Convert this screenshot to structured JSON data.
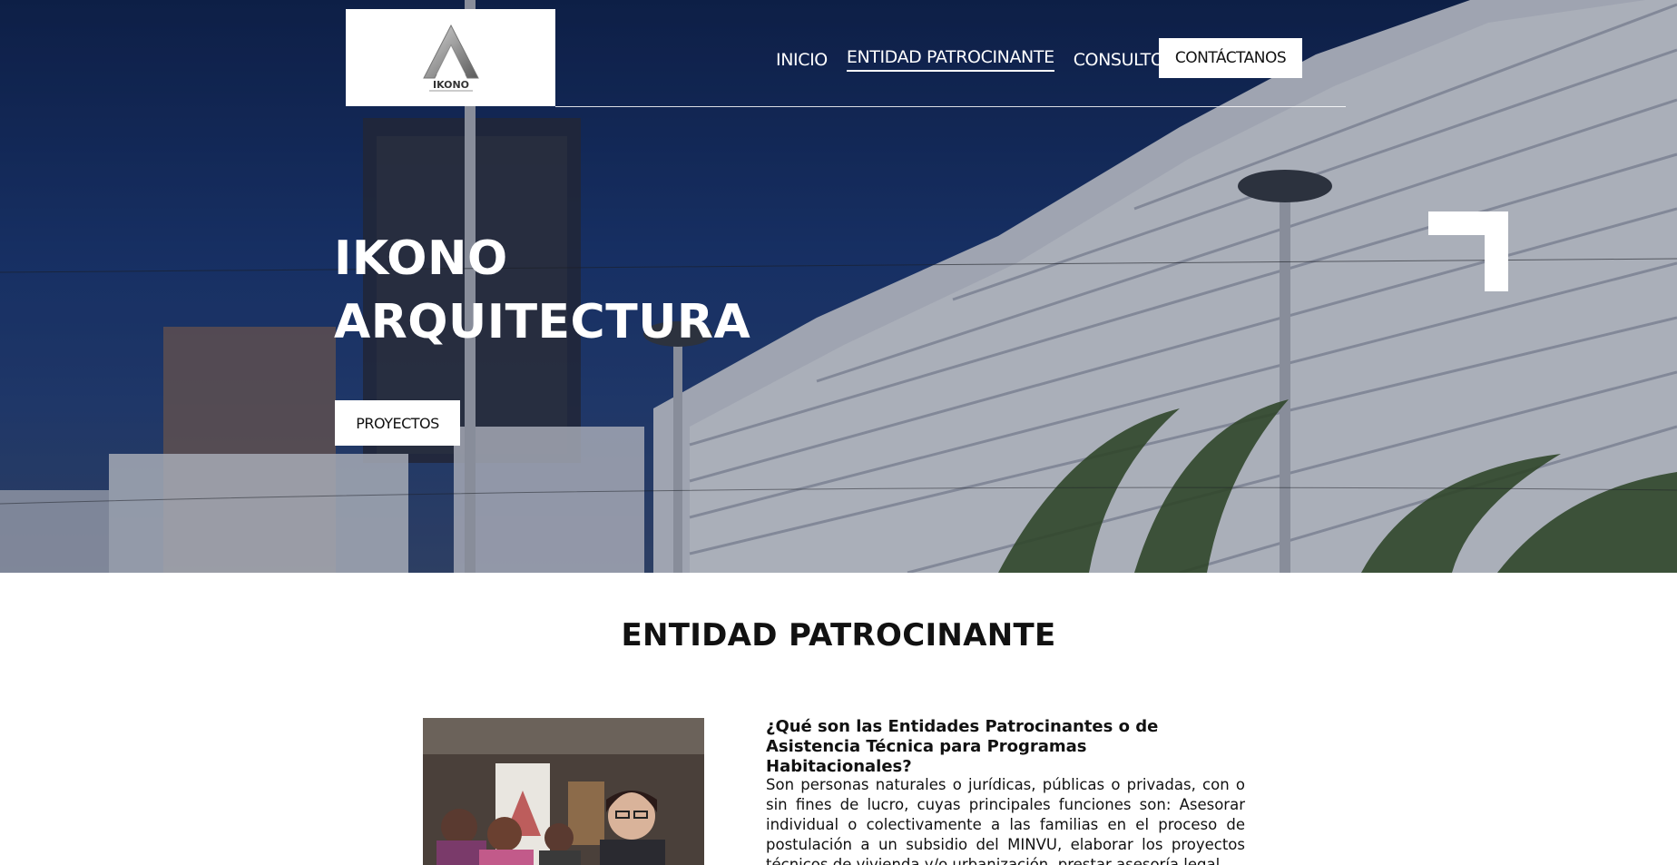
{
  "header": {
    "logo_text": "IKONO",
    "nav": [
      {
        "label": "INICIO",
        "active": false
      },
      {
        "label": "ENTIDAD PATROCINANTE",
        "active": true
      },
      {
        "label": "CONSULTORA",
        "active": false
      }
    ],
    "contact_label": "CONTÁCTANOS"
  },
  "hero": {
    "title_line1": "IKONO",
    "title_line2": "ARQUITECTURA",
    "projects_label": "PROYECTOS"
  },
  "section": {
    "title": "ENTIDAD PATROCINANTE",
    "question": "¿Qué son las Entidades Patrocinantes o de Asistencia Técnica para Programas Habitacionales?",
    "paragraph": "Son personas naturales o jurídicas, públicas o privadas, con o sin fines de lucro, cuyas principales funciones son: Asesorar individual o colectivamente a las familias en el proceso de postulación a un subsidio del MINVU, elaborar los proyectos técnicos de vivienda y/o urbanización, prestar asesoría legal"
  },
  "colors": {
    "hero_sky": "#1c3a78",
    "text_dark": "#111111",
    "white": "#ffffff"
  }
}
